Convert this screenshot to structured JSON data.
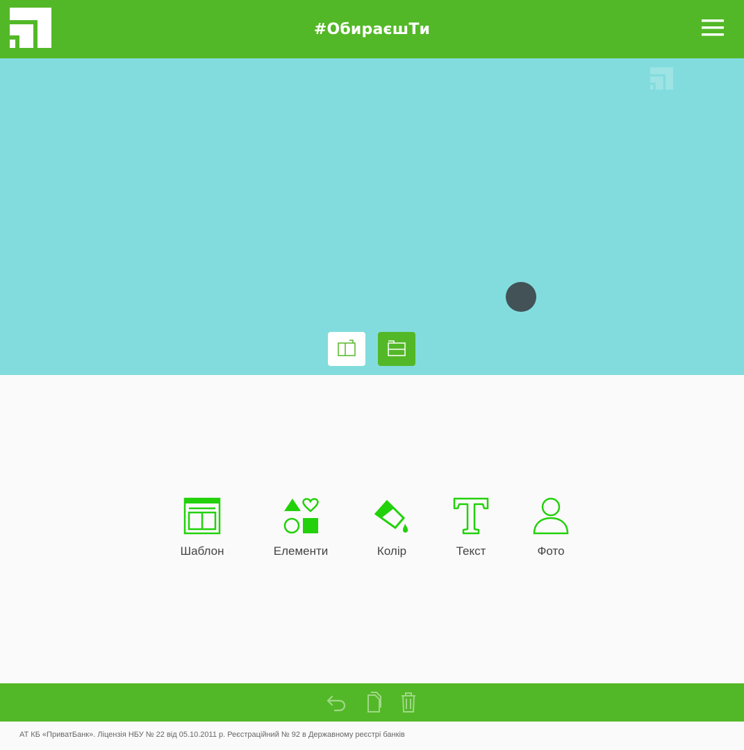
{
  "header": {
    "title": "#ОбираєшТи",
    "logo_icon": "privatbank-logo-icon",
    "menu_icon": "hamburger-menu-icon"
  },
  "canvas": {
    "background": "#82dcdd",
    "watermark_icon": "privatbank-watermark-icon",
    "orientation_buttons": [
      {
        "icon": "portrait-orientation-icon",
        "selected": false
      },
      {
        "icon": "landscape-orientation-icon",
        "selected": true
      }
    ]
  },
  "tools": [
    {
      "label": "Шаблон",
      "icon": "template-icon"
    },
    {
      "label": "Елементи",
      "icon": "elements-icon"
    },
    {
      "label": "Колір",
      "icon": "paint-bucket-icon"
    },
    {
      "label": "Текст",
      "icon": "text-icon"
    },
    {
      "label": "Фото",
      "icon": "person-photo-icon"
    }
  ],
  "bottom_bar": {
    "icons": [
      "undo-icon",
      "copy-icon",
      "trash-icon"
    ]
  },
  "footer": {
    "legal_text": "АТ КБ «ПриватБанк». Ліцензія НБУ № 22 від 05.10.2011 р. Реєстраційний № 92 в Державному реєстрі банків"
  },
  "colors": {
    "brand_green": "#53b827",
    "icon_green": "#22d10a",
    "canvas_blue": "#82dcdd"
  }
}
